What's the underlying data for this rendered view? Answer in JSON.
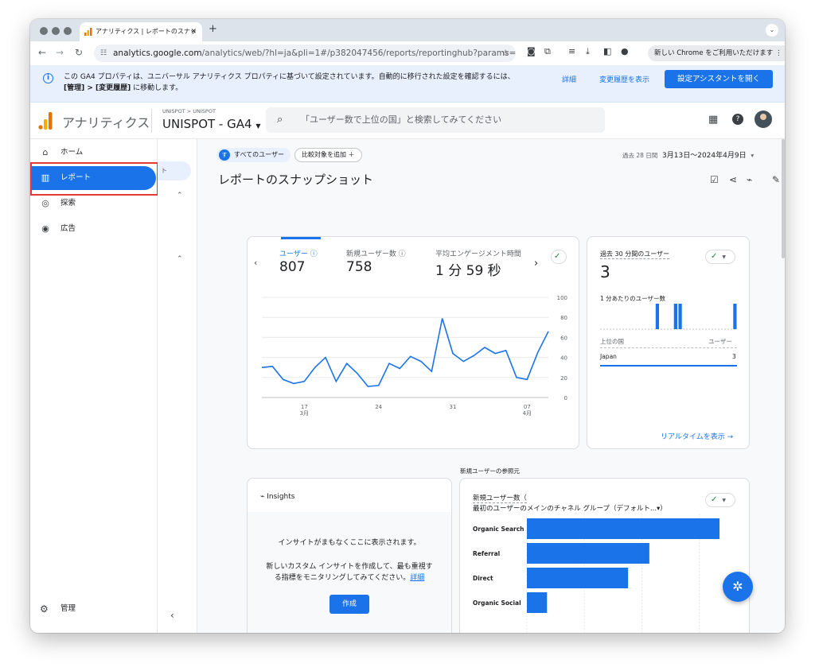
{
  "browser": {
    "tab_title": "アナリティクス | レポートのスナッ",
    "tab_close": "✕",
    "new_tab": "+",
    "url_host": "analytics.google.com",
    "url_path": "/analytics/web/?hl=ja&pli=1#/p382047456/reports/reportinghub?params=_u..nav%3D...",
    "chrome_button": "新しい Chrome をご利用いただけます"
  },
  "banner": {
    "line1": "この GA4 プロパティは、ユニバーサル アナリティクス プロパティに基づいて設定されています。自動的に移行された設定を確認するには、",
    "line2_bold": "[管理] > [変更履歴]",
    "line2_rest": " に移動します。",
    "details": "詳細",
    "history": "変更履歴を表示",
    "cta": "設定アシスタントを開く"
  },
  "header": {
    "app_name": "アナリティクス",
    "breadcrumb": "UNISPOT > UNISPOT",
    "property": "UNISPOT - GA4",
    "search_placeholder": "「ユーザー数で上位の国」と検索してみてください"
  },
  "sidebar": {
    "items": [
      {
        "label": "ホーム"
      },
      {
        "label": "レポート"
      },
      {
        "label": "探索"
      },
      {
        "label": "広告"
      }
    ],
    "admin": "管理",
    "sub_pill": "ト"
  },
  "main": {
    "chip_all_users": "すべてのユーザー",
    "chip_all_dot": "す",
    "chip_add": "比較対象を追加 ＋",
    "date_prefix": "過去 28 日間",
    "date_range": "3月13日～2024年4月9日",
    "title": "レポートのスナップショット",
    "kpi": [
      {
        "label": "ユーザー ⓘ",
        "value": "807"
      },
      {
        "label": "新規ユーザー数 ⓘ",
        "value": "758"
      },
      {
        "label": "平均エンゲージメント時間",
        "value": "1 分 59 秒"
      }
    ],
    "realtime": {
      "label": "過去 30 分間のユーザー",
      "value": "3",
      "per_minute": "1 分あたりのユーザー数",
      "col_country": "上位の国",
      "col_users": "ユーザー",
      "row_country": "Japan",
      "row_value": "3",
      "link": "リアルタイムを表示 →"
    },
    "insights": {
      "title": "Insights",
      "msg1": "インサイトがまもなくここに表示されます。",
      "msg2": "新しいカスタム インサイトを作成して、最も重視す",
      "msg3": "る指標をモニタリングしてみてください。",
      "msg3_link": "詳細",
      "button": "作成"
    },
    "acq": {
      "section_label": "新規ユーザーの参照元",
      "title1": "新規ユーザー数（",
      "title2": "最初のユーザーのメインのチャネル グループ（デフォルト...▾）"
    }
  },
  "chart_data": [
    {
      "type": "line",
      "title": "",
      "x": [
        "3/13",
        "3/14",
        "3/15",
        "3/16",
        "3/17",
        "3/18",
        "3/19",
        "3/20",
        "3/21",
        "3/22",
        "3/23",
        "3/24",
        "3/25",
        "3/26",
        "3/27",
        "3/28",
        "3/29",
        "3/30",
        "3/31",
        "4/1",
        "4/2",
        "4/3",
        "4/4",
        "4/5",
        "4/6",
        "4/7",
        "4/8",
        "4/9"
      ],
      "series": [
        {
          "values": [
            30,
            31,
            18,
            14,
            16,
            30,
            40,
            16,
            34,
            24,
            11,
            12,
            34,
            29,
            41,
            36,
            26,
            79,
            44,
            36,
            42,
            50,
            44,
            47,
            20,
            18,
            45,
            66
          ]
        }
      ],
      "x_ticks": [
        {
          "label": "17",
          "sub": "3月",
          "x": "3/17"
        },
        {
          "label": "24",
          "sub": "",
          "x": "3/24"
        },
        {
          "label": "31",
          "sub": "",
          "x": "3/31"
        },
        {
          "label": "07",
          "sub": "4月",
          "x": "4/7"
        }
      ],
      "y_ticks": [
        0,
        20,
        40,
        60,
        80,
        100
      ],
      "ylim": [
        0,
        100
      ]
    },
    {
      "type": "bar",
      "title": "1 分あたりのユーザー数",
      "categories": [
        "1",
        "2",
        "3",
        "4",
        "5",
        "6",
        "7",
        "8",
        "9",
        "10",
        "11",
        "12",
        "13",
        "14",
        "15",
        "16",
        "17",
        "18",
        "19",
        "20",
        "21",
        "22",
        "23",
        "24",
        "25",
        "26",
        "27",
        "28",
        "29",
        "30"
      ],
      "values": [
        0,
        0,
        0,
        0,
        0,
        0,
        0,
        0,
        0,
        0,
        0,
        0,
        1,
        0,
        0,
        0,
        1,
        1,
        0,
        0,
        0,
        0,
        0,
        0,
        0,
        0,
        0,
        0,
        0,
        1
      ]
    },
    {
      "type": "bar",
      "orientation": "horizontal",
      "categories": [
        "Organic Search",
        "Referral",
        "Direct",
        "Organic Social"
      ],
      "values": [
        335,
        213,
        176,
        35
      ],
      "x_ticks": [
        0,
        100,
        200,
        300
      ],
      "xlim": [
        0,
        335
      ]
    }
  ],
  "colors": {
    "accent": "#1a73e8",
    "highlight_box": "#e53935",
    "success": "#188038"
  },
  "icons": [
    "home-icon",
    "bar-chart-icon",
    "explore-icon",
    "ads-icon",
    "gear-icon",
    "search-icon",
    "apps-icon",
    "help-icon"
  ]
}
